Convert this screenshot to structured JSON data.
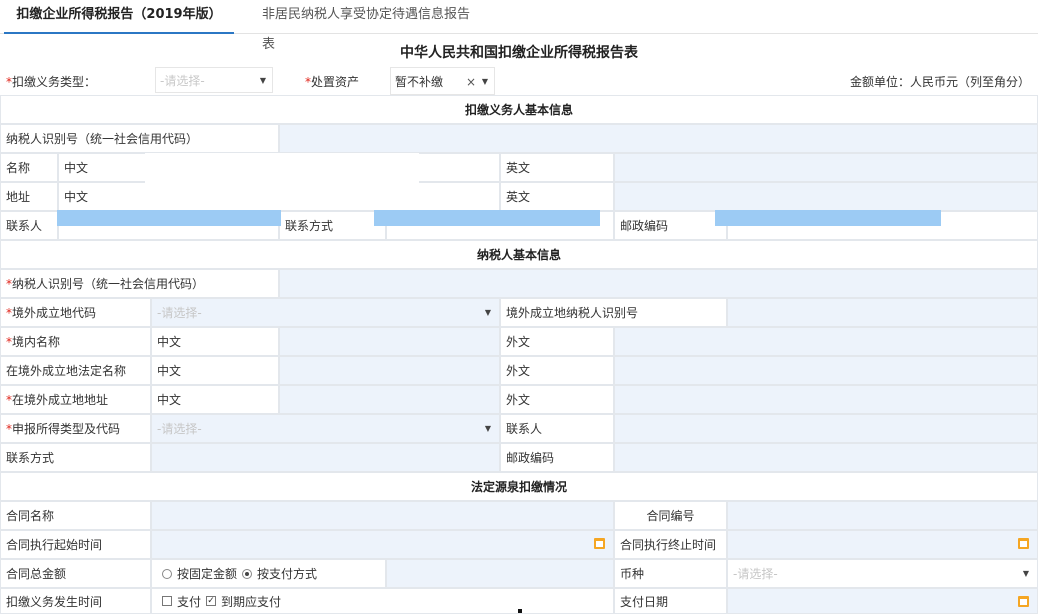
{
  "tabs": [
    {
      "label": "扣缴企业所得税报告（2019年版）"
    },
    {
      "label": "非居民纳税人享受协定待遇信息报告表"
    }
  ],
  "title": "中华人民共和国扣缴企业所得税报告表",
  "header": {
    "withholding_type_label": "扣缴义务类型：",
    "withholding_type_placeholder": "-请选择-",
    "dispose_asset_label": "处置资产",
    "dispose_asset_value": "暂不补缴",
    "clear_symbol": "×",
    "currency_note": "金额单位：人民币元（列至角分）"
  },
  "sections": {
    "withholder": "扣缴义务人基本信息",
    "taxpayer": "纳税人基本信息",
    "legal_source": "法定源泉扣缴情况"
  },
  "withholder": {
    "tax_id_label": "纳税人识别号（统一社会信用代码）",
    "name_label": "名称",
    "chinese": "中文",
    "english": "英文",
    "address_label": "地址",
    "contact_label": "联系人",
    "contact_method_label": "联系方式",
    "postal_label": "邮政编码"
  },
  "taxpayer": {
    "tax_id_label": "纳税人识别号（统一社会信用代码）",
    "country_code_label": "境外成立地代码",
    "placeholder": "-请选择-",
    "overseas_tax_id_label": "境外成立地纳税人识别号",
    "domestic_name_label": "境内名称",
    "chinese": "中文",
    "foreign": "外文",
    "overseas_legal_name_label": "在境外成立地法定名称",
    "overseas_address_label": "在境外成立地地址",
    "income_type_label": "申报所得类型及代码",
    "contact_label": "联系人",
    "contact_method_label": "联系方式",
    "postal_label": "邮政编码"
  },
  "contract": {
    "name_label": "合同名称",
    "number_label": "合同编号",
    "start_label": "合同执行起始时间",
    "end_label": "合同执行终止时间",
    "total_label": "合同总金额",
    "option_fixed": "按固定金额",
    "option_payment": "按支付方式",
    "currency_label": "币种",
    "currency_placeholder": "-请选择-",
    "occur_label": "扣缴义务发生时间",
    "opt_pay": "支付",
    "opt_due": "到期应支付",
    "pay_date_label": "支付日期"
  },
  "check_mark": "✓",
  "icons": {
    "dropdown": "▼",
    "calendar": "calendar-icon"
  }
}
